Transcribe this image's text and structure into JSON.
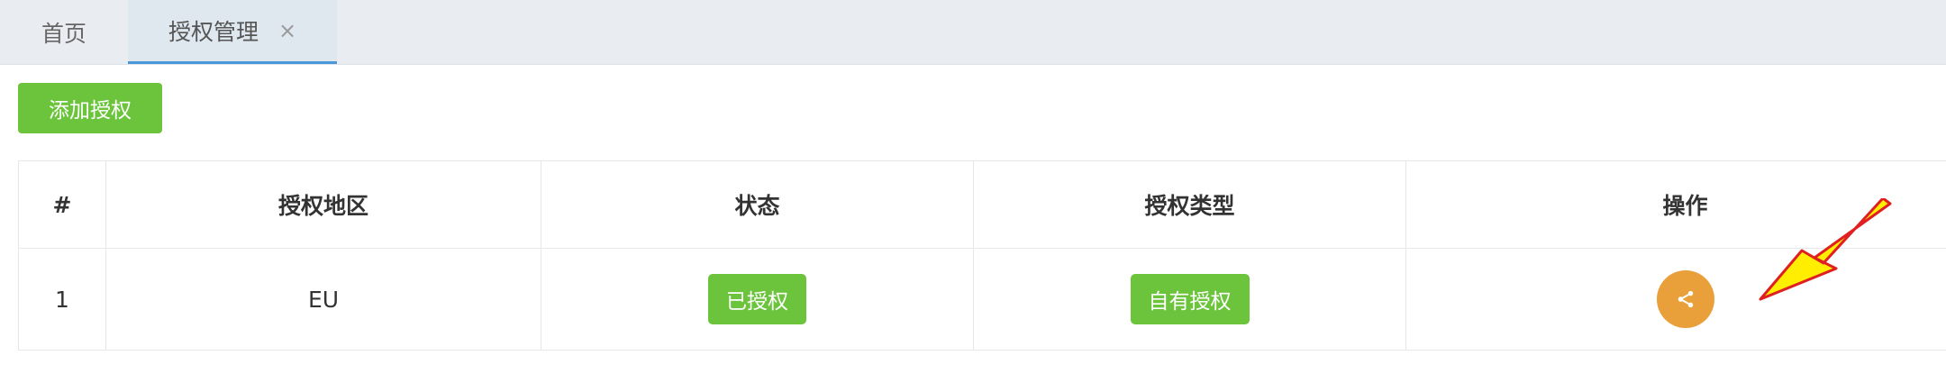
{
  "tabs": [
    {
      "label": "首页",
      "active": false
    },
    {
      "label": "授权管理",
      "active": true,
      "close": "×"
    }
  ],
  "toolbar": {
    "add_label": "添加授权"
  },
  "table": {
    "headers": [
      "#",
      "授权地区",
      "状态",
      "授权类型",
      "操作"
    ],
    "rows": [
      {
        "index": "1",
        "region": "EU",
        "status": "已授权",
        "type": "自有授权",
        "action_icon": "share-icon"
      }
    ]
  },
  "colors": {
    "accent_green": "#6cc43d",
    "action_orange": "#e9a03a",
    "active_tab_underline": "#4a98d8",
    "annotation_arrow": "#ffee00"
  }
}
